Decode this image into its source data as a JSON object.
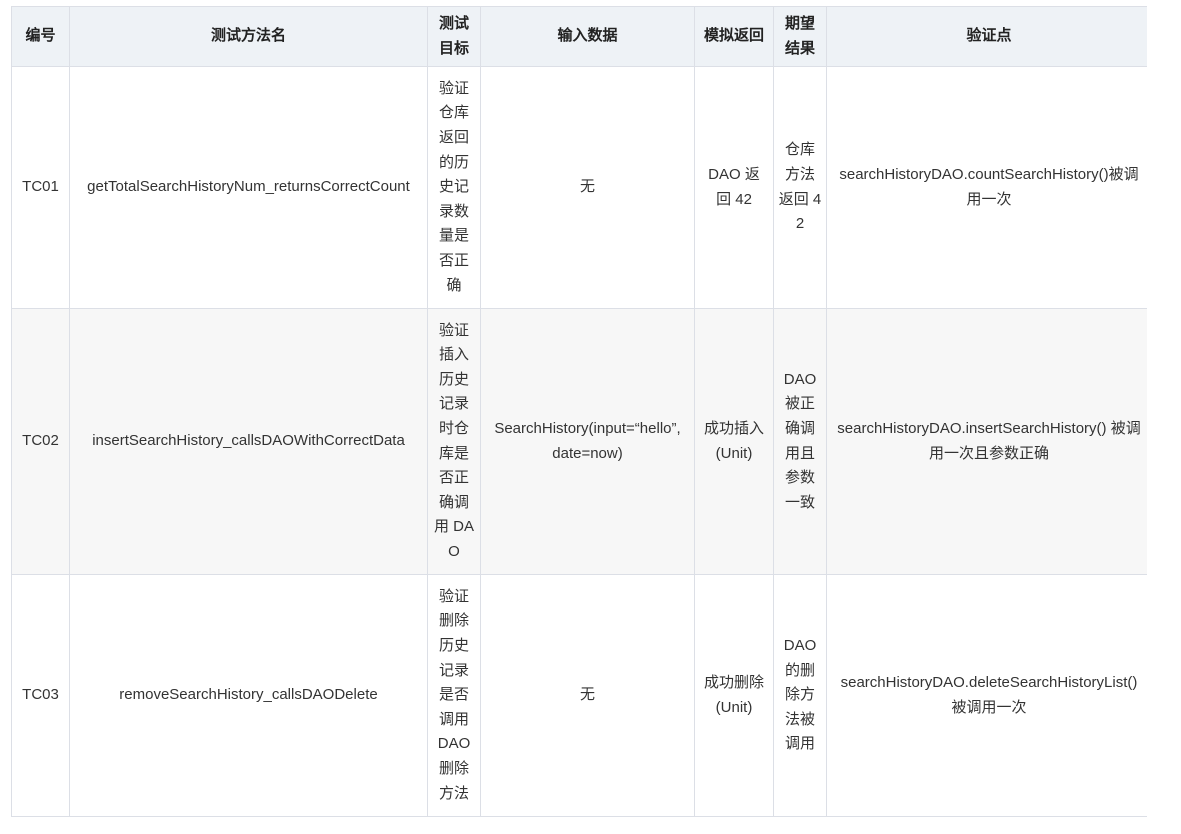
{
  "table": {
    "headers": {
      "id": "编号",
      "method": "测试方法名",
      "goal": "测试目标",
      "input": "输入数据",
      "mock": "模拟返回",
      "expected": "期望结果",
      "verify": "验证点"
    },
    "rows": [
      {
        "id": "TC01",
        "method": "getTotalSearchHistoryNum_returnsCorrectCount",
        "goal": "验证仓库返回的历史记录数量是否正确",
        "input": "无",
        "mock": "DAO 返回 42",
        "expected": "仓库方法返回 42",
        "verify": "searchHistoryDAO.countSearchHistory()被调用一次"
      },
      {
        "id": "TC02",
        "method": "insertSearchHistory_callsDAOWithCorrectData",
        "goal": "验证插入历史记录时仓库是否正确调用 DAO",
        "input": "SearchHistory(input=“hello”, date=now)",
        "mock": "成功插入 (Unit)",
        "expected": "DAO 被正确调用且参数一致",
        "verify": "searchHistoryDAO.insertSearchHistory() 被调用一次且参数正确"
      },
      {
        "id": "TC03",
        "method": "removeSearchHistory_callsDAODelete",
        "goal": "验证删除历史记录是否调用 DAO 删除方法",
        "input": "无",
        "mock": "成功删除 (Unit)",
        "expected": "DAO 的删除方法被调用",
        "verify": "searchHistoryDAO.deleteSearchHistoryList() 被调用一次"
      }
    ]
  }
}
